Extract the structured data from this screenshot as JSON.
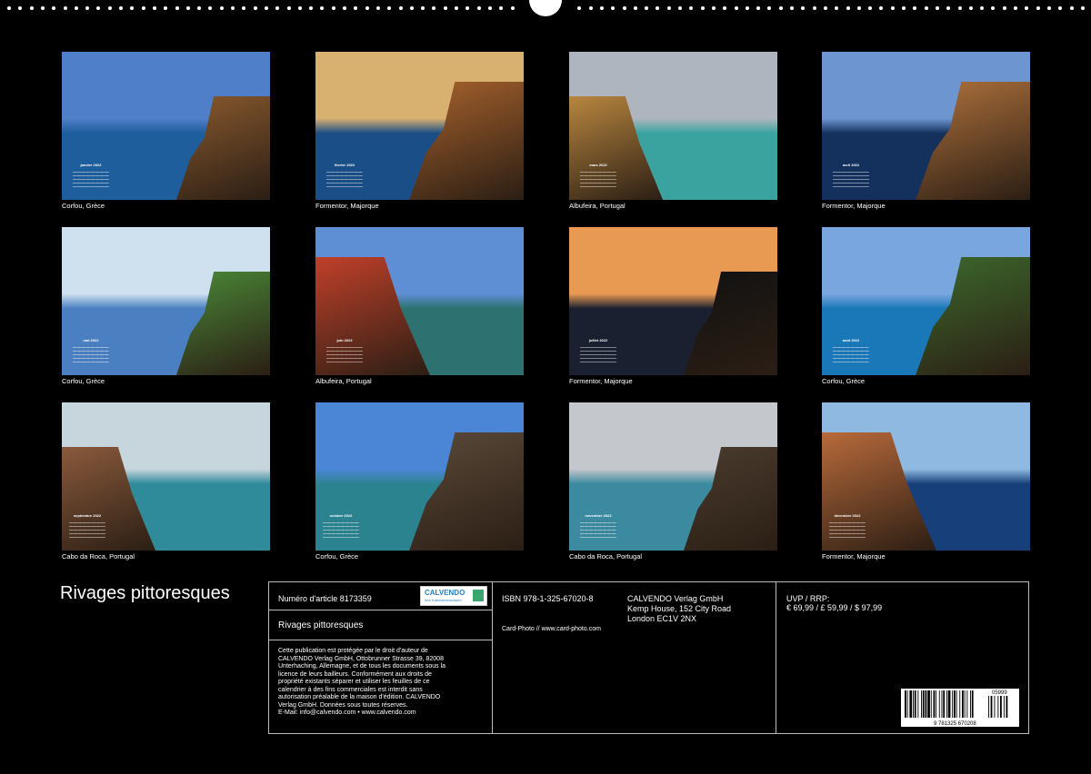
{
  "grid": [
    {
      "caption": "Corfou, Grèce",
      "month": "janvier 2022",
      "sky": "#4f7fc9",
      "sea": "#1e5e9c",
      "land": "#8a5a2e"
    },
    {
      "caption": "Formentor, Majorque",
      "month": "février 2022",
      "sky": "#d8b070",
      "sea": "#1a4e86",
      "land": "#a8622c"
    },
    {
      "caption": "Albufeira, Portugal",
      "month": "mars 2022",
      "sky": "#aeb5be",
      "sea": "#3aa3a0",
      "land": "#b8863f"
    },
    {
      "caption": "Formentor, Majorque",
      "month": "avril 2022",
      "sky": "#6d95d0",
      "sea": "#14315e",
      "land": "#b0723c"
    },
    {
      "caption": "Corfou, Grèce",
      "month": "mai 2022",
      "sky": "#cfe0ef",
      "sea": "#4a7fc1",
      "land": "#4a8a38"
    },
    {
      "caption": "Albufeira, Portugal",
      "month": "juin 2022",
      "sky": "#5e8ed4",
      "sea": "#2d7170",
      "land": "#c0402a"
    },
    {
      "caption": "Formentor, Majorque",
      "month": "juillet 2022",
      "sky": "#e89a52",
      "sea": "#1a2030",
      "land": "#111111"
    },
    {
      "caption": "Corfou, Grèce",
      "month": "août 2022",
      "sky": "#7aa6e0",
      "sea": "#1a78b8",
      "land": "#3c6a2c"
    },
    {
      "caption": "Cabo da Roca, Portugal",
      "month": "septembre 2022",
      "sky": "#c7d5dc",
      "sea": "#2f8a9a",
      "land": "#8a5a3c"
    },
    {
      "caption": "Corfou, Grèce",
      "month": "octobre 2022",
      "sky": "#4b86d6",
      "sea": "#2c8390",
      "land": "#5b4a3a"
    },
    {
      "caption": "Cabo da Roca, Portugal",
      "month": "novembre 2022",
      "sky": "#c4c7cc",
      "sea": "#3c8aa0",
      "land": "#4a3c2e"
    },
    {
      "caption": "Formentor, Majorque",
      "month": "décembre 2022",
      "sky": "#8fb9e0",
      "sea": "#173f7a",
      "land": "#b86a3a"
    }
  ],
  "title": "Rivages pittoresques",
  "info": {
    "article": "Numéro d'article 8173359",
    "subtitle": "Rivages pittoresques",
    "legal": [
      "Cette publication est protégée par le droit d'auteur de",
      "CALVENDO Verlag GmbH, Ottobrunner Strasse 39, 82008",
      "Unterhaching, Allemagne, et de tous les documents sous la",
      "licence de leurs bailleurs. Conformément aux droits de",
      "propriété existants séparer et utiliser les feuilles de ce",
      "calendrier à des fins commerciales est interdit sans",
      "autorisation préalable de la maison d'édition. CALVENDO",
      "Verlag GmbH. Données sous toutes réserves.",
      "E-Mail: info@calvendo.com • www.calvendo.com"
    ],
    "logo_name": "CALVENDO",
    "logo_sub": "Ihre Kalendermacherei",
    "logo_color": "#2a7fbf",
    "isbn": "ISBN 978-1-325-67020-8",
    "credit": "Card-Photo // www.card-photo.com",
    "publisher": [
      "CALVENDO Verlag GmbH",
      "Kemp House, 152 City Road",
      "London EC1V 2NX"
    ],
    "price_label": "UVP / RRP:",
    "price": "€ 69,99 / £ 59,99 / $ 97,99",
    "barcode_addon": "05999",
    "barcode_digits": "9 781325 670208"
  }
}
